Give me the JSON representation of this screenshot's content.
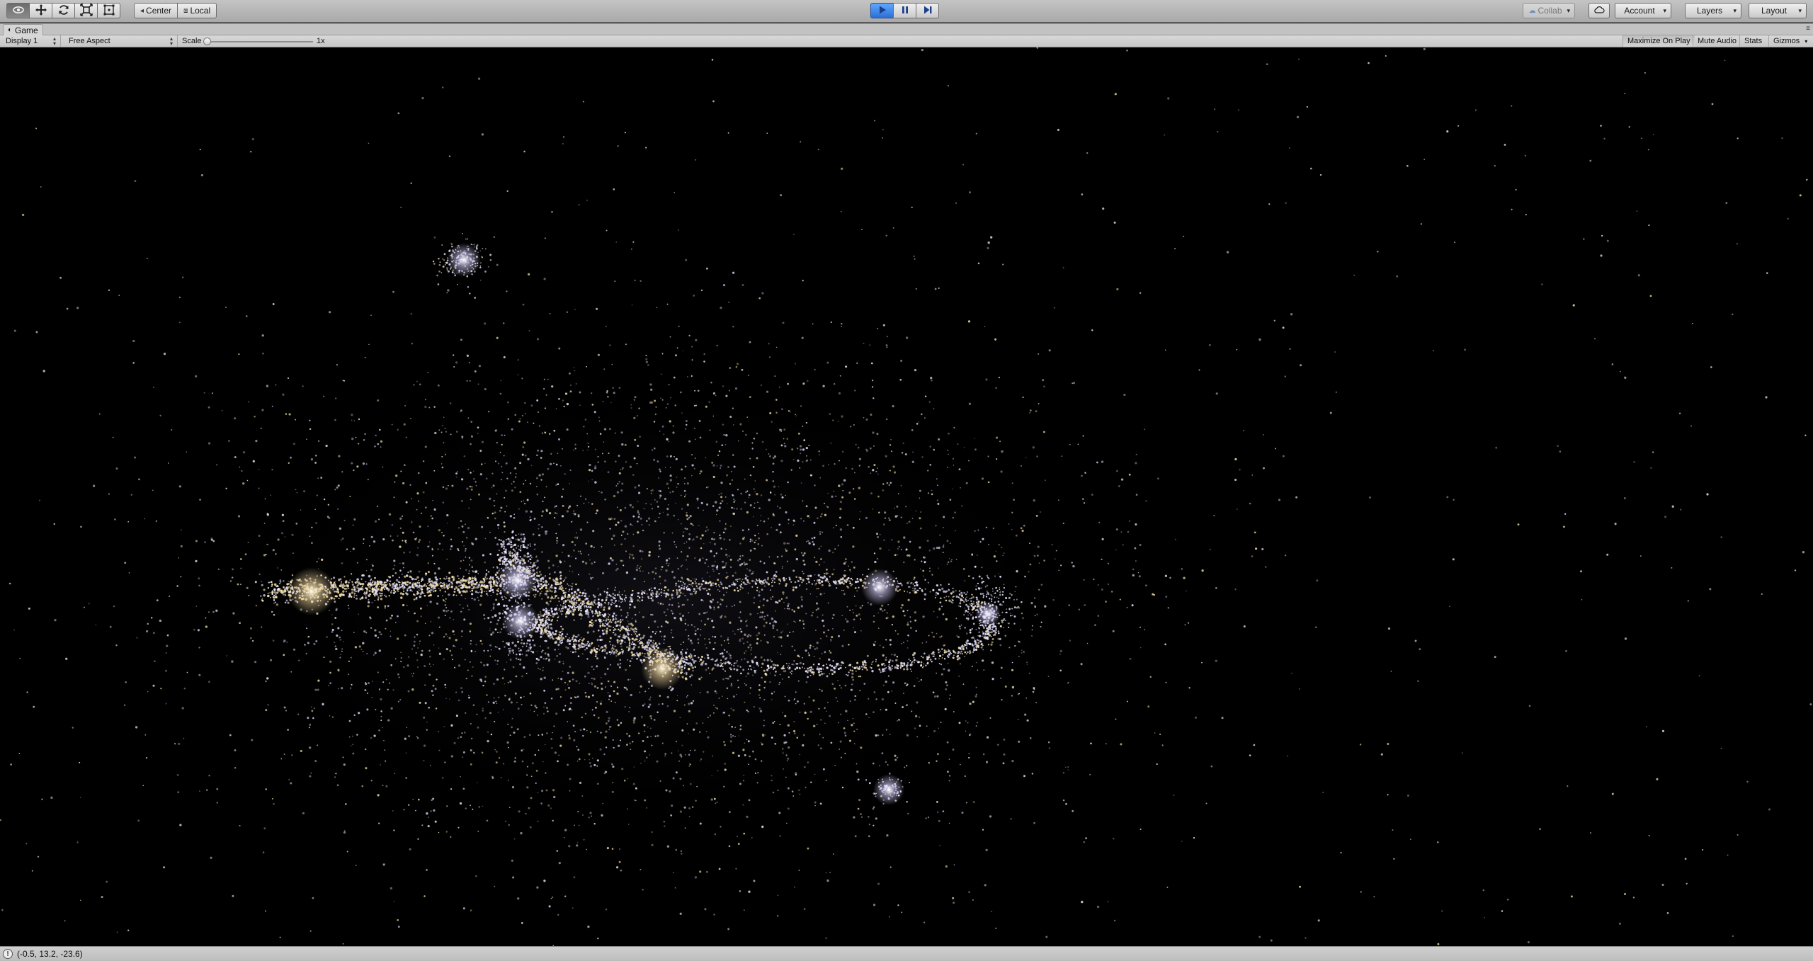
{
  "toolbar": {
    "tools": [
      {
        "name": "hand-tool",
        "icon": "eye-icon",
        "active": true
      },
      {
        "name": "move-tool",
        "icon": "move-arrows-icon",
        "active": false
      },
      {
        "name": "rotate-tool",
        "icon": "rotate-icon",
        "active": false
      },
      {
        "name": "scale-tool",
        "icon": "scale-icon",
        "active": false
      },
      {
        "name": "rect-tool",
        "icon": "rect-tool-icon",
        "active": false
      }
    ],
    "pivot_mode": "Center",
    "pivot_rotation": "Local",
    "playback": {
      "play_icon": "play-icon",
      "pause_icon": "pause-icon",
      "step_icon": "step-icon",
      "playing": true
    },
    "collab_label": "Collab",
    "cloud_icon": "cloud-icon",
    "account_label": "Account",
    "layers_label": "Layers",
    "layout_label": "Layout"
  },
  "tab": {
    "title": "Game",
    "icon": "game-view-icon"
  },
  "game_bar": {
    "display": "Display 1",
    "aspect": "Free Aspect",
    "scale_label": "Scale",
    "scale_value": "1x",
    "scale_fraction": 0.0,
    "maximize_on_play": "Maximize On Play",
    "mute_audio": "Mute Audio",
    "stats": "Stats",
    "gizmos": "Gizmos"
  },
  "status": {
    "icon": "info-icon",
    "message": "(-0.5, 13.2, -23.6)"
  },
  "colors": {
    "toolbar_bg": "#b5b5b5",
    "play_active": "#3d86f0",
    "viewport_bg": "#000000",
    "particle_white": "#e6e2ff",
    "particle_warm": "#f4dfa8"
  }
}
